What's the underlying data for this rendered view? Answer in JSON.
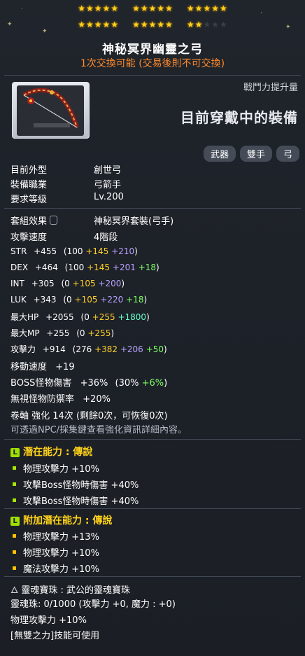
{
  "stars": {
    "row1": [
      5,
      5,
      5,
      5
    ],
    "row2": [
      5,
      5,
      5
    ],
    "total_filled": 22,
    "total": 25
  },
  "item": {
    "name": "神秘冥界幽靈之弓",
    "trade_note": "1次交換可能 (交易後則不可交換)",
    "cp_label": "戰鬥力提升量",
    "equipped_label": "目前穿戴中的裝備",
    "tags": [
      "武器",
      "雙手",
      "弓"
    ]
  },
  "basic": [
    {
      "k": "目前外型",
      "v": "創世弓"
    },
    {
      "k": "裝備職業",
      "v": "弓箭手"
    },
    {
      "k": "要求等級",
      "v": "Lv.200"
    }
  ],
  "set": {
    "k": "套組效果",
    "v": "神秘冥界套裝(弓手)"
  },
  "speed": {
    "k": "攻擊速度",
    "v": "4階段"
  },
  "stats": [
    {
      "k": "STR",
      "total": "+455",
      "base": "(100",
      "p1": "+145",
      "p2": "+210",
      "p3": "",
      "close": ")"
    },
    {
      "k": "DEX",
      "total": "+464",
      "base": "(100",
      "p1": "+145",
      "p2": "+201",
      "p3": "+18",
      "close": ")"
    },
    {
      "k": "INT",
      "total": "+305",
      "base": "(0",
      "p1": "+105",
      "p2": "+200",
      "p3": "",
      "close": ")"
    },
    {
      "k": "LUK",
      "total": "+343",
      "base": "(0",
      "p1": "+105",
      "p2": "+220",
      "p3": "+18",
      "close": ")"
    },
    {
      "k": "最大HP",
      "total": "+2055",
      "base": "(0",
      "p1": "+255",
      "p2": "",
      "p3": "+1800",
      "close": ")"
    },
    {
      "k": "最大MP",
      "total": "+255",
      "base": "(0",
      "p1": "+255",
      "p2": "",
      "p3": "",
      "close": ")"
    },
    {
      "k": "攻擊力",
      "total": "+914",
      "base": "(276",
      "p1": "+382",
      "p2": "+206",
      "p3": "+50",
      "close": ")"
    }
  ],
  "extra": [
    {
      "k": "移動速度",
      "v": "+19"
    },
    {
      "k": "BOSS怪物傷害",
      "v": "+36%",
      "detail": "(30%",
      "g": "+6%",
      "close": ")"
    },
    {
      "k": "無視怪物防禦率",
      "v": "+20%"
    }
  ],
  "scroll": {
    "line1": "卷軸 強化 14次 (剩餘0次，可恢復0次)",
    "line2": "可透過NPC/採集鍵查看強化資訊詳細內容。"
  },
  "potential": {
    "header": "潛在能力 : 傳說",
    "badge": "L",
    "lines": [
      "物理攻擊力 +10%",
      "攻擊Boss怪物時傷害 +40%",
      "攻擊Boss怪物時傷害 +40%"
    ]
  },
  "bonus": {
    "header": "附加潛在能力 : 傳說",
    "badge": "L",
    "lines": [
      "物理攻擊力 +13%",
      "物理攻擊力 +10%",
      "魔法攻擊力 +10%"
    ]
  },
  "soul": {
    "name_line": "靈魂寶珠 : 武公的靈魂寶珠",
    "count_line": "靈魂珠:  0/1000 (攻擊力 +0, 魔力 : +0)",
    "effect_line": "物理攻擊力 +10%",
    "skill_line": "[無雙之力]技能可使用"
  },
  "colors": {
    "star_on": "#ffd21a",
    "subtitle": "#ff8a2b",
    "flame": "#ffd02a",
    "star_force": "#b6a3ff",
    "potential_bonus": "#7dff66",
    "potential_header": "#ffd21a"
  }
}
